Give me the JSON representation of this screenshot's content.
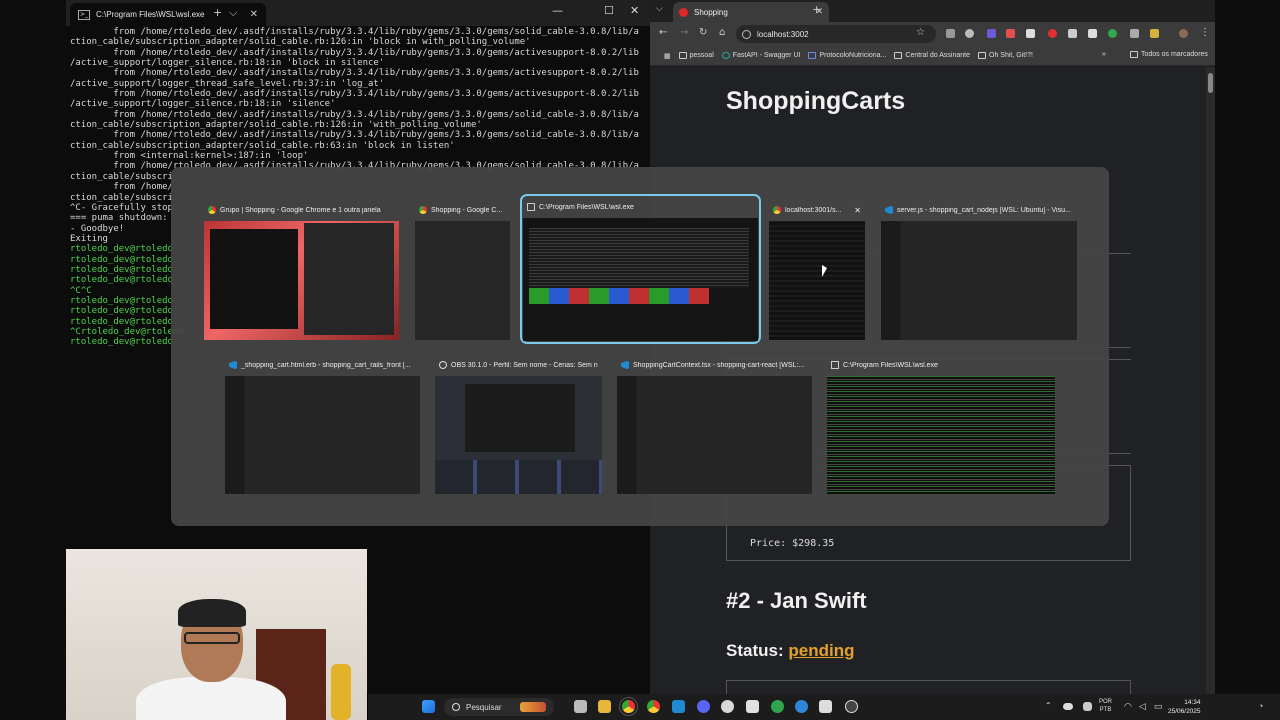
{
  "terminal": {
    "tab_title": "C:\\Program Files\\WSL\\wsl.exe",
    "new_tab": "+",
    "dropdown": "⌵",
    "close_tab": "✕",
    "window_controls": [
      "—",
      "☐",
      "✕"
    ],
    "lines": [
      "        from /home/rtoledo_dev/.asdf/installs/ruby/3.3.4/lib/ruby/gems/3.3.0/gems/solid_cable-3.0.8/lib/a",
      "ction_cable/subscription_adapter/solid_cable.rb:126:in 'block in with_polling_volume'",
      "        from /home/rtoledo_dev/.asdf/installs/ruby/3.3.4/lib/ruby/gems/3.3.0/gems/activesupport-8.0.2/lib",
      "/active_support/logger_silence.rb:18:in 'block in silence'",
      "        from /home/rtoledo_dev/.asdf/installs/ruby/3.3.4/lib/ruby/gems/3.3.0/gems/activesupport-8.0.2/lib",
      "/active_support/logger_thread_safe_level.rb:37:in 'log_at'",
      "        from /home/rtoledo_dev/.asdf/installs/ruby/3.3.4/lib/ruby/gems/3.3.0/gems/activesupport-8.0.2/lib",
      "/active_support/logger_silence.rb:18:in 'silence'",
      "        from /home/rtoledo_dev/.asdf/installs/ruby/3.3.4/lib/ruby/gems/3.3.0/gems/solid_cable-3.0.8/lib/a",
      "ction_cable/subscription_adapter/solid_cable.rb:126:in 'with_polling_volume'",
      "        from /home/rtoledo_dev/.asdf/installs/ruby/3.3.4/lib/ruby/gems/3.3.0/gems/solid_cable-3.0.8/lib/a",
      "ction_cable/subscription_adapter/solid_cable.rb:63:in 'block in listen'",
      "        from <internal:kernel>:187:in 'loop'",
      "        from /home/rtoledo_dev/.asdf/installs/ruby/3.3.4/lib/ruby/gems/3.3.0/gems/solid_cable-3.0.8/lib/a",
      "ction_cable/subscri",
      "        from /home/",
      "ction_cable/subscri",
      "^C- Gracefully stop",
      "=== puma shutdown:",
      "- Goodbye!",
      "Exiting"
    ],
    "prompt_lines": [
      "rtoledo_dev@rtoledo",
      "rtoledo_dev@rtoledo",
      "rtoledo_dev@rtoledo",
      "rtoledo_dev@rtoledo",
      "^C^C",
      "rtoledo_dev@rtoledo",
      "rtoledo_dev@rtoledo",
      "rtoledo_dev@rtoledo",
      "^Crtoledo_dev@rtoledo",
      "rtoledo_dev@rtoledo"
    ]
  },
  "browser": {
    "tab_title": "Shopping",
    "close_tab": "✕",
    "new_tab": "+",
    "url": "localhost:3002",
    "bookmarks": [
      "pessoal",
      "FastAPI - Swagger UI",
      "ProtocoloNutriciona...",
      "Central do Assinante",
      "Oh Shit, Git!?!"
    ],
    "bookmarks_overflow": "»",
    "all_bookmarks": "Todos os marcadores",
    "page": {
      "title": "ShoppingCarts",
      "price": "Price: $298.35",
      "order_heading": "#2 - Jan Swift",
      "status_label": "Status:",
      "status_value": "pending"
    }
  },
  "switcher": {
    "windows": [
      {
        "title": "Grupo | Shopping - Google Chrome e 1 outra janela",
        "icon": "chrome-icon"
      },
      {
        "title": "Shopping - Google C...",
        "icon": "chrome-icon"
      },
      {
        "title": "C:\\Program Files\\WSL\\wsl.exe",
        "icon": "terminal-icon",
        "selected": true
      },
      {
        "title": "localhost:3001/s...",
        "icon": "chrome-icon",
        "close": "✕"
      },
      {
        "title": "server.js - shopping_cart_nodejs [WSL: Ubuntu] - Visu...",
        "icon": "vscode-icon"
      },
      {
        "title": "_shopping_cart.html.erb - shopping_cart_rails_front [...",
        "icon": "vscode-icon"
      },
      {
        "title": "OBS 30.1.0 - Perfil: Sem nome - Cenas: Sem n...",
        "icon": "obs-icon"
      },
      {
        "title": "ShoppingCartContext.tsx - shopping-cart-react [WSL:...",
        "icon": "vscode-icon"
      },
      {
        "title": "C:\\Program Files\\WSL\\wsl.exe",
        "icon": "terminal-icon"
      }
    ]
  },
  "taskbar": {
    "search_placeholder": "Pesquisar",
    "language": [
      "POR",
      "PTB"
    ],
    "time": "14:34",
    "date": "25/06/2025"
  }
}
